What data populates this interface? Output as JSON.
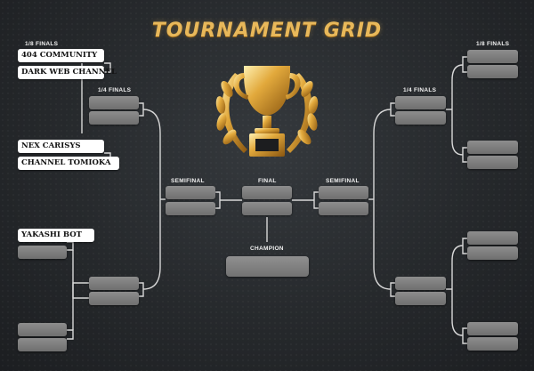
{
  "title": "TOURNAMENT GRID",
  "rounds": {
    "eighth": "1/8 FINALS",
    "quarter": "1/4 FINALS",
    "semi": "SEMIFINAL",
    "final": "FINAL",
    "champion": "CHAMPION"
  },
  "teams": {
    "t1": "404 COMMUNITY",
    "t2": "DARK WEB CHANNEL",
    "t3": "NEX CARISYS",
    "t4": "CHANNEL TOMIOKA",
    "t5": "YAKASHI BOT"
  },
  "colors": {
    "title_gold": "#e8b85a",
    "slot_gray": "#7e7e7e",
    "filled_slot": "#ffffff",
    "background": "#2a2d30"
  },
  "icons": [
    "trophy-icon",
    "laurel-wreath-icon"
  ]
}
